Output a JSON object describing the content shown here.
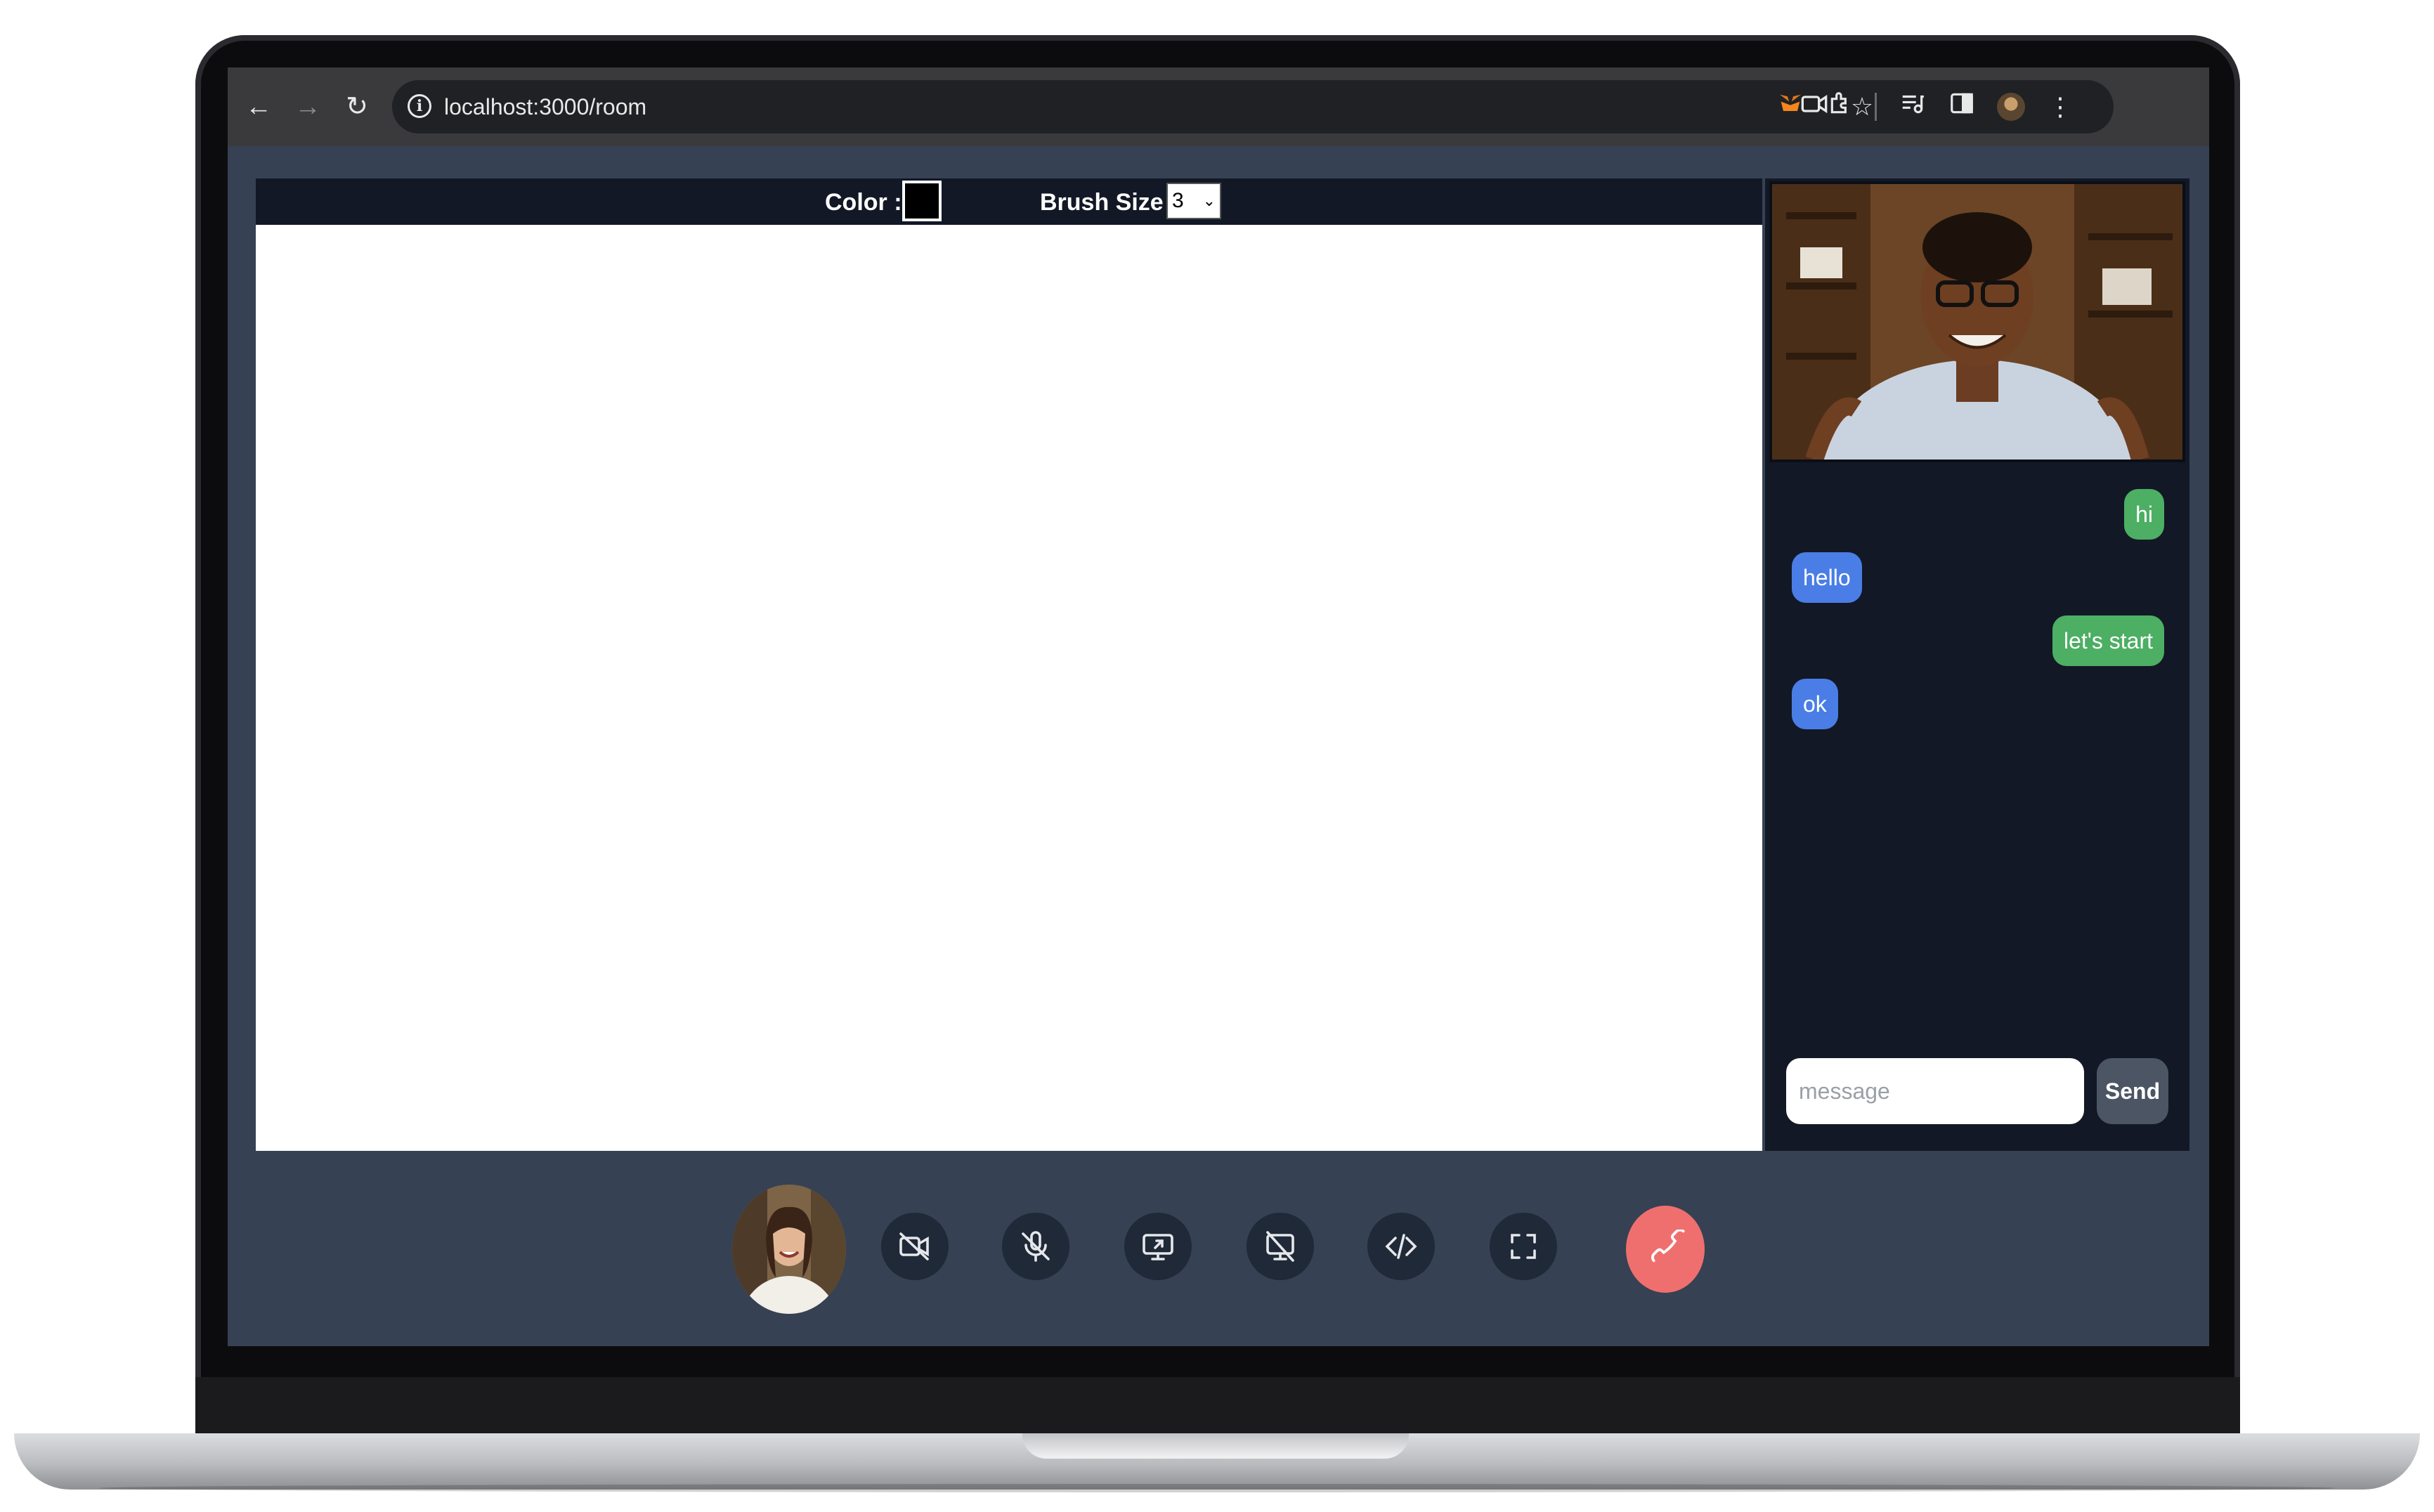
{
  "browser": {
    "url": "localhost:3000/room",
    "info_glyph": "i"
  },
  "toolbar": {
    "color_label": "Color :",
    "color_value": "#000000",
    "brush_label": "Brush Size :",
    "brush_value": "3"
  },
  "chat": {
    "messages": [
      {
        "text": "hi",
        "from": "me"
      },
      {
        "text": "hello",
        "from": "them"
      },
      {
        "text": "let's start",
        "from": "me"
      },
      {
        "text": "ok",
        "from": "them"
      }
    ],
    "input_placeholder": "message",
    "send_label": "Send"
  },
  "controls": {
    "icons": [
      "video-off-icon",
      "mic-off-icon",
      "screen-share-icon",
      "stop-share-icon",
      "code-icon",
      "fullscreen-icon",
      "hang-up-icon"
    ]
  },
  "colors": {
    "screen_bg": "#364153",
    "panel_bg": "#121826",
    "my_bubble": "#4caf63",
    "their_bubble": "#4a7ee6",
    "hang_up": "#ef6f6f"
  }
}
